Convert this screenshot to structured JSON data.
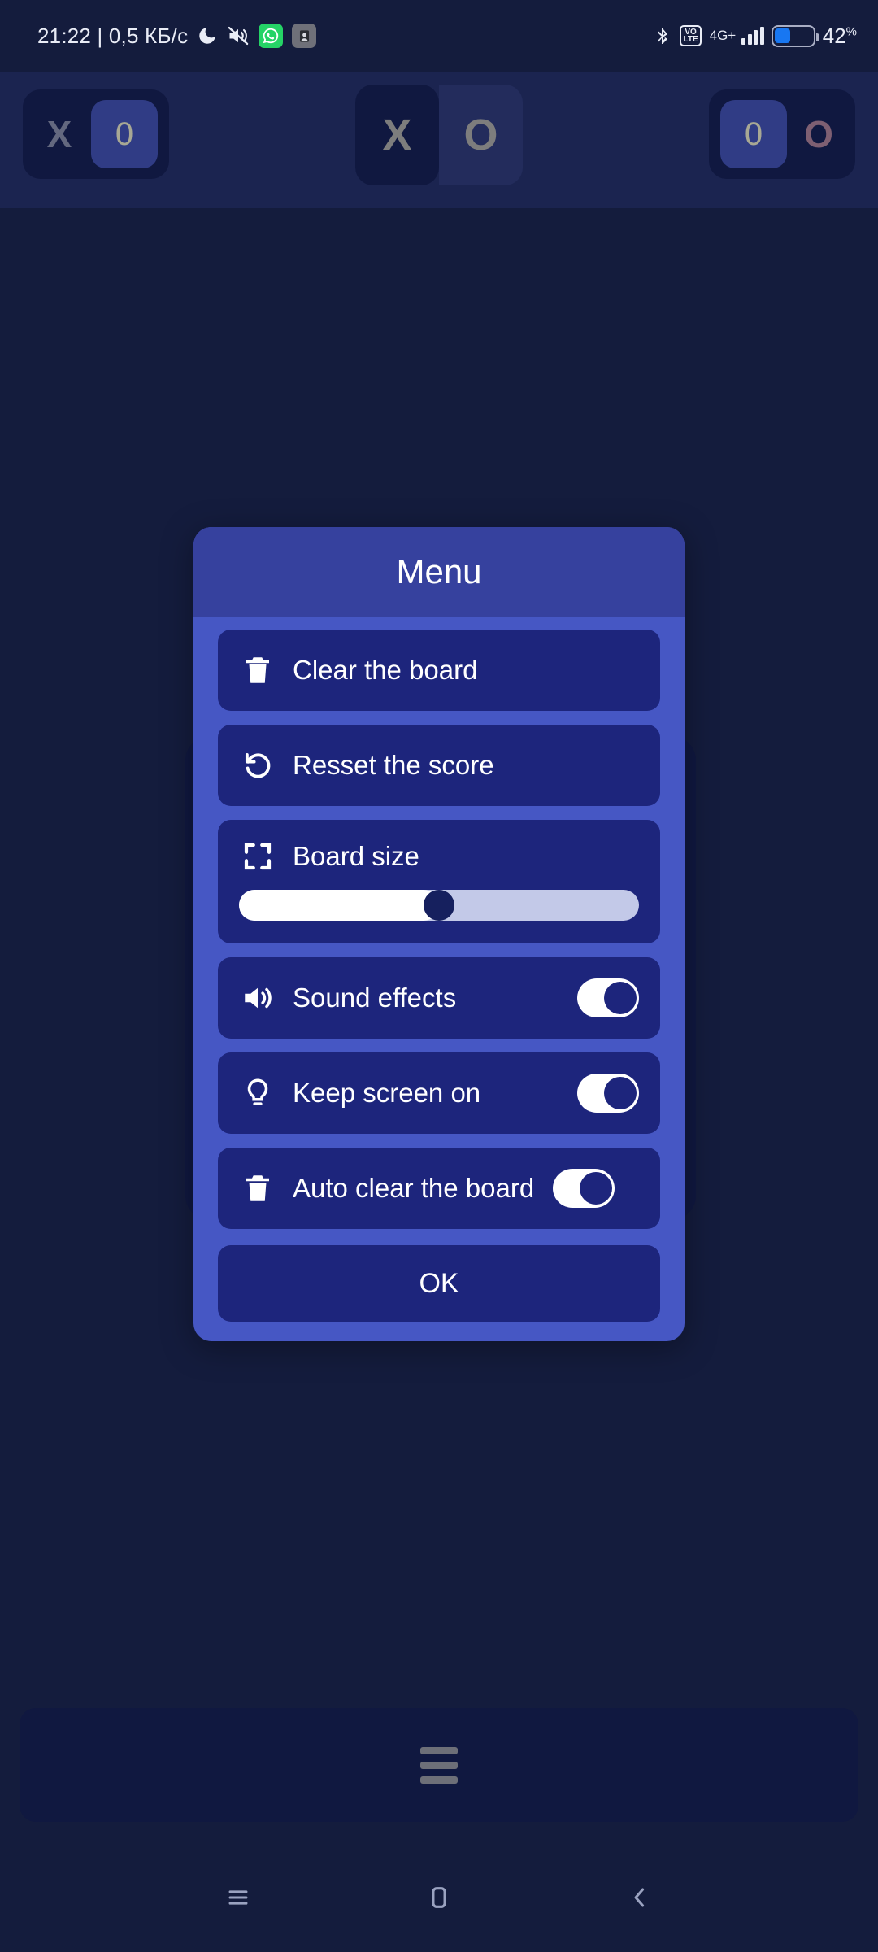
{
  "statusbar": {
    "time_and_rate": "21:22 | 0,5 КБ/с",
    "left_icons": [
      "moon-dnd-icon",
      "mute-icon",
      "whatsapp-icon",
      "app-icon"
    ],
    "bluetooth": "bluetooth-icon",
    "volte_line1": "VO",
    "volte_line2": "LTE",
    "network": "4G+",
    "signal": "signal-bars-icon",
    "battery_percent": "42",
    "battery_percent_symbol": "%",
    "battery_level": 42,
    "battery_color": "#1877f2"
  },
  "game_header": {
    "player_x": {
      "mark": "X",
      "score": "0"
    },
    "player_o": {
      "mark": "O",
      "score": "0"
    },
    "turn_indicator": {
      "x": "X",
      "o": "O",
      "active": "X"
    }
  },
  "dialog": {
    "title": "Menu",
    "items": [
      {
        "icon": "trash-icon",
        "label": "Clear the board",
        "control": "none"
      },
      {
        "icon": "undo-icon",
        "label": "Resset the score",
        "control": "none"
      },
      {
        "icon": "fullscreen-icon",
        "label": "Board size",
        "control": "slider",
        "slider_value": 50
      },
      {
        "icon": "volume-icon",
        "label": "Sound effects",
        "control": "toggle",
        "toggle_on": true
      },
      {
        "icon": "lightbulb-icon",
        "label": "Keep screen on",
        "control": "toggle",
        "toggle_on": true
      },
      {
        "icon": "trash-icon",
        "label": "Auto clear the board",
        "control": "toggle",
        "toggle_on": true
      }
    ],
    "ok_label": "OK",
    "header_color": "#36419e",
    "body_color": "#4657c4",
    "item_color": "#1d257c"
  },
  "bottom_bar": {
    "menu_icon": "hamburger-icon"
  },
  "navbar": {
    "recents": "recents-icon",
    "home": "home-icon",
    "back": "back-icon"
  }
}
